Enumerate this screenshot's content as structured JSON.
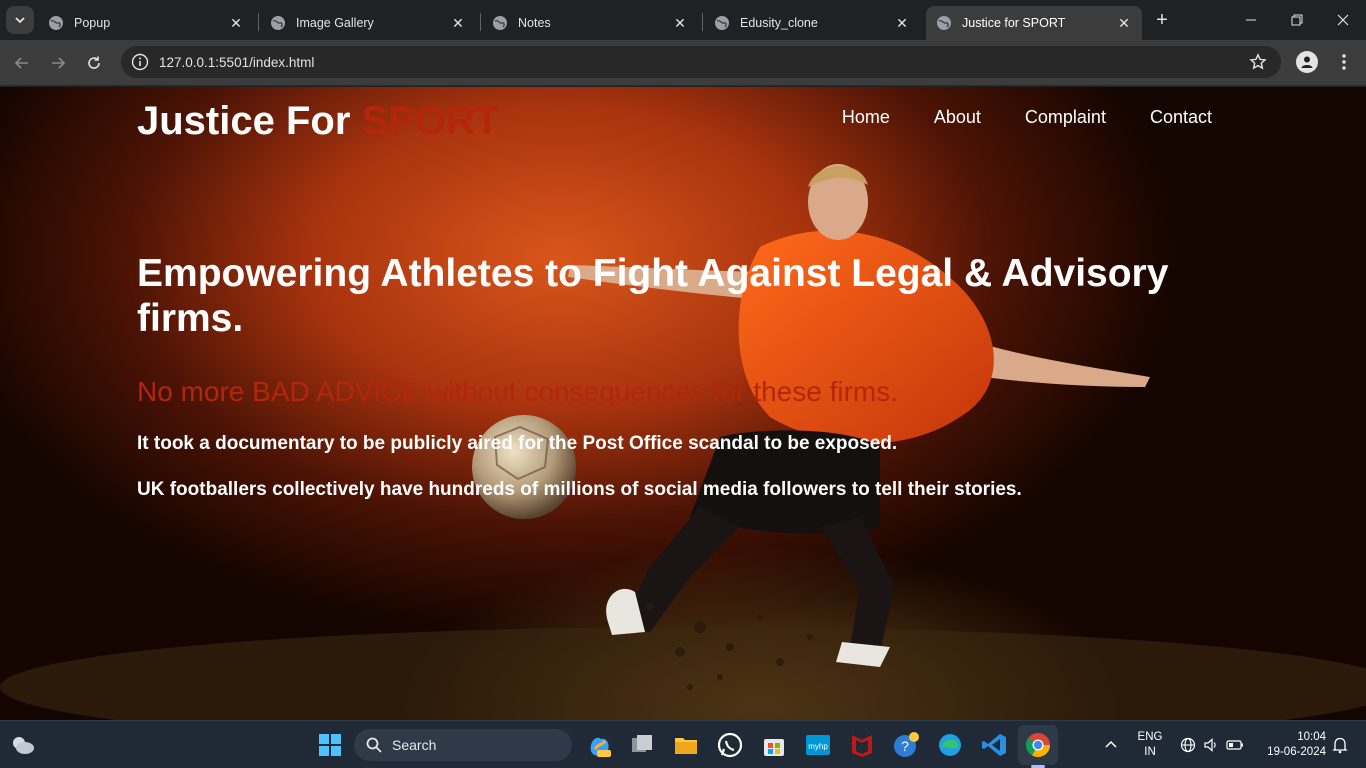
{
  "browser": {
    "tabs": [
      {
        "title": "Popup",
        "active": false
      },
      {
        "title": "Image Gallery",
        "active": false
      },
      {
        "title": "Notes",
        "active": false
      },
      {
        "title": "Edusity_clone",
        "active": false
      },
      {
        "title": "Justice for SPORT",
        "active": true
      }
    ],
    "url": "127.0.0.1:5501/index.html"
  },
  "page": {
    "logo_main": "Justice For ",
    "logo_accent": "SPORT",
    "nav": [
      "Home",
      "About",
      "Complaint",
      "Contact"
    ],
    "hero_title": "Empowering Athletes to Fight Against Legal & Advisory firms.",
    "hero_subtitle": "No more BAD ADVICE without consequences for these firms.",
    "hero_p1": "It took a documentary to be publicly aired for the Post Office scandal to be exposed.",
    "hero_p2": "UK footballers collectively have hundreds of millions of social media followers to tell their stories.",
    "accent_color": "#b3260c"
  },
  "taskbar": {
    "search_label": "Search",
    "lang_line1": "ENG",
    "lang_line2": "IN",
    "time": "10:04",
    "date": "19-06-2024"
  }
}
